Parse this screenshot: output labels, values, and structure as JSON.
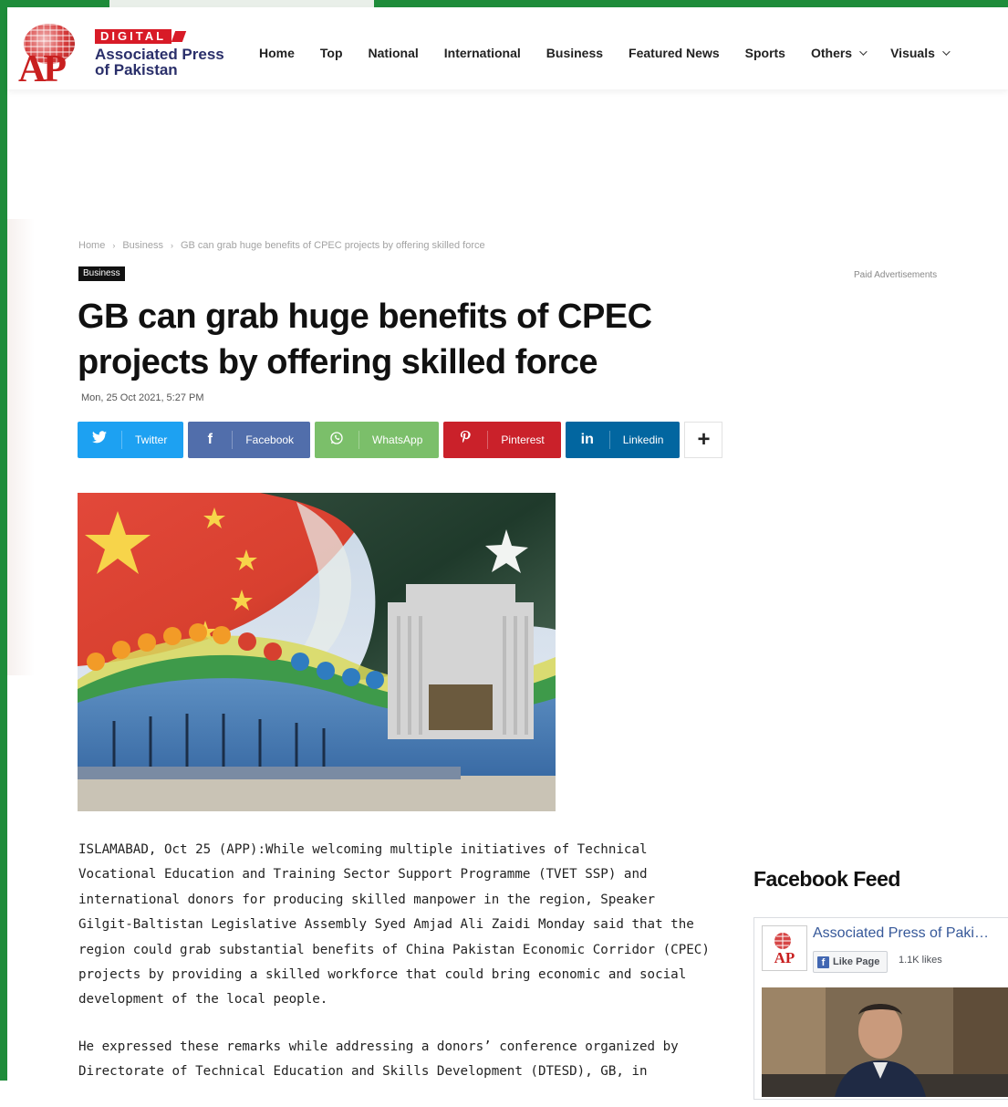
{
  "logo": {
    "digital": "DIGITAL",
    "line1": "Associated Press",
    "line2": "of Pakistan",
    "mark": "AP"
  },
  "nav": {
    "items": [
      "Home",
      "Top",
      "National",
      "International",
      "Business",
      "Featured News",
      "Sports"
    ],
    "others": "Others",
    "visuals": "Visuals"
  },
  "breadcrumb": {
    "home": "Home",
    "section": "Business",
    "current": "GB can grab huge benefits of CPEC projects by offering skilled force"
  },
  "category_badge": "Business",
  "article": {
    "title": "GB can grab huge benefits of CPEC projects by offering skilled force",
    "date": "Mon, 25 Oct 2021, 5:27 PM",
    "paragraphs": [
      "ISLAMABAD, Oct 25 (APP):While welcoming multiple initiatives of Technical Vocational Education and Training Sector Support Programme (TVET SSP) and international donors for producing skilled manpower in the region, Speaker Gilgit-Baltistan Legislative Assembly Syed Amjad Ali Zaidi Monday said that the region could grab substantial benefits of China Pakistan Economic Corridor (CPEC) projects by providing a skilled workforce that could bring economic and social development of the local people.",
      "He expressed these remarks while addressing a donors’ conference organized by Directorate of Technical Education and Skills Development (DTESD), GB, in"
    ]
  },
  "share": [
    {
      "label": "Twitter",
      "icon": "twitter-icon",
      "color": "#1da1f2"
    },
    {
      "label": "Facebook",
      "icon": "facebook-icon",
      "color": "#516eab"
    },
    {
      "label": "WhatsApp",
      "icon": "whatsapp-icon",
      "color": "#7bbf6a"
    },
    {
      "label": "Pinterest",
      "icon": "pinterest-icon",
      "color": "#ca212a"
    },
    {
      "label": "Linkedin",
      "icon": "linkedin-icon",
      "color": "#0266a0"
    }
  ],
  "sidebar": {
    "paid_ads": "Paid Advertisements",
    "facebook_feed": "Facebook Feed",
    "fb_page_name": "Associated Press of Paki…",
    "fb_like": "Like Page",
    "fb_likes": "1.1K likes"
  }
}
